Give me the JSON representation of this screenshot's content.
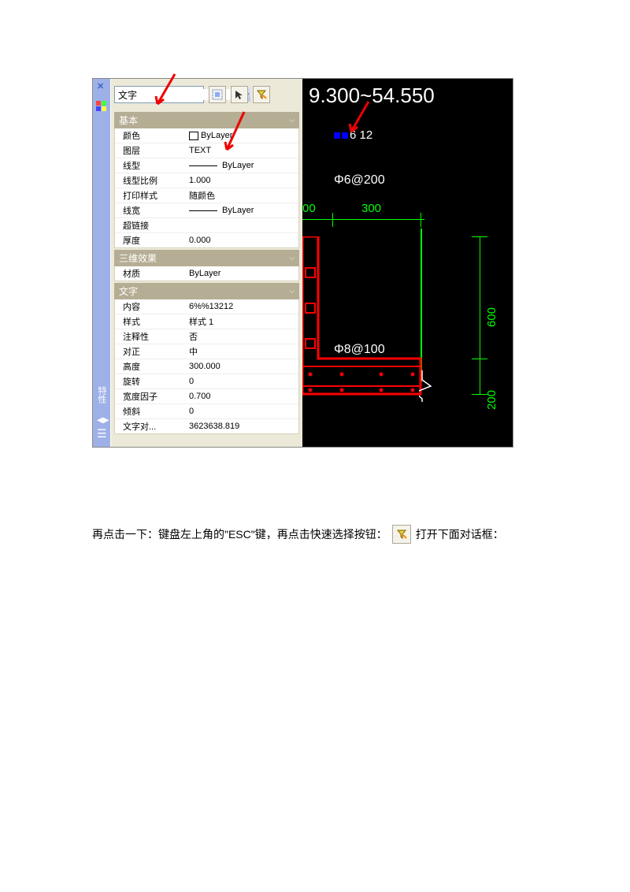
{
  "toolbar": {
    "type_value": "文字",
    "icon1": "select-sim-icon",
    "icon2": "select-obj-icon",
    "icon3": "quick-select-icon"
  },
  "sections": {
    "basic": {
      "title": "基本",
      "rows": [
        {
          "label": "颜色",
          "value": "ByLayer",
          "swatch": true
        },
        {
          "label": "图层",
          "value": "TEXT"
        },
        {
          "label": "线型",
          "value": "ByLayer",
          "line": true
        },
        {
          "label": "线型比例",
          "value": "1.000"
        },
        {
          "label": "打印样式",
          "value": "随颜色"
        },
        {
          "label": "线宽",
          "value": "ByLayer",
          "line": true
        },
        {
          "label": "超链接",
          "value": ""
        },
        {
          "label": "厚度",
          "value": "0.000"
        }
      ]
    },
    "threeD": {
      "title": "三维效果",
      "rows": [
        {
          "label": "材质",
          "value": "ByLayer"
        }
      ]
    },
    "text": {
      "title": "文字",
      "rows": [
        {
          "label": "内容",
          "value": "6%%13212"
        },
        {
          "label": "样式",
          "value": "样式 1"
        },
        {
          "label": "注释性",
          "value": "否"
        },
        {
          "label": "对正",
          "value": "中"
        },
        {
          "label": "高度",
          "value": "300.000"
        },
        {
          "label": "旋转",
          "value": "0"
        },
        {
          "label": "宽度因子",
          "value": "0.700"
        },
        {
          "label": "倾斜",
          "value": "0"
        },
        {
          "label": "文字对...",
          "value": "3623638.819"
        }
      ]
    }
  },
  "sidebar": {
    "vert_label": "特性"
  },
  "cad": {
    "title_range": "9.300~54.550",
    "label_rebar1": "6  12",
    "label_rebar2": "Φ6@200",
    "label_rebar3": "Φ8@100",
    "dim1": "300",
    "dim2": "00",
    "dim3": "600",
    "dim4": "200"
  },
  "caption": {
    "part1": "再点击一下：键盘左上角的\"ESC\"键，再点击快速选择按钮：",
    "part2": "打开下面对话框："
  }
}
